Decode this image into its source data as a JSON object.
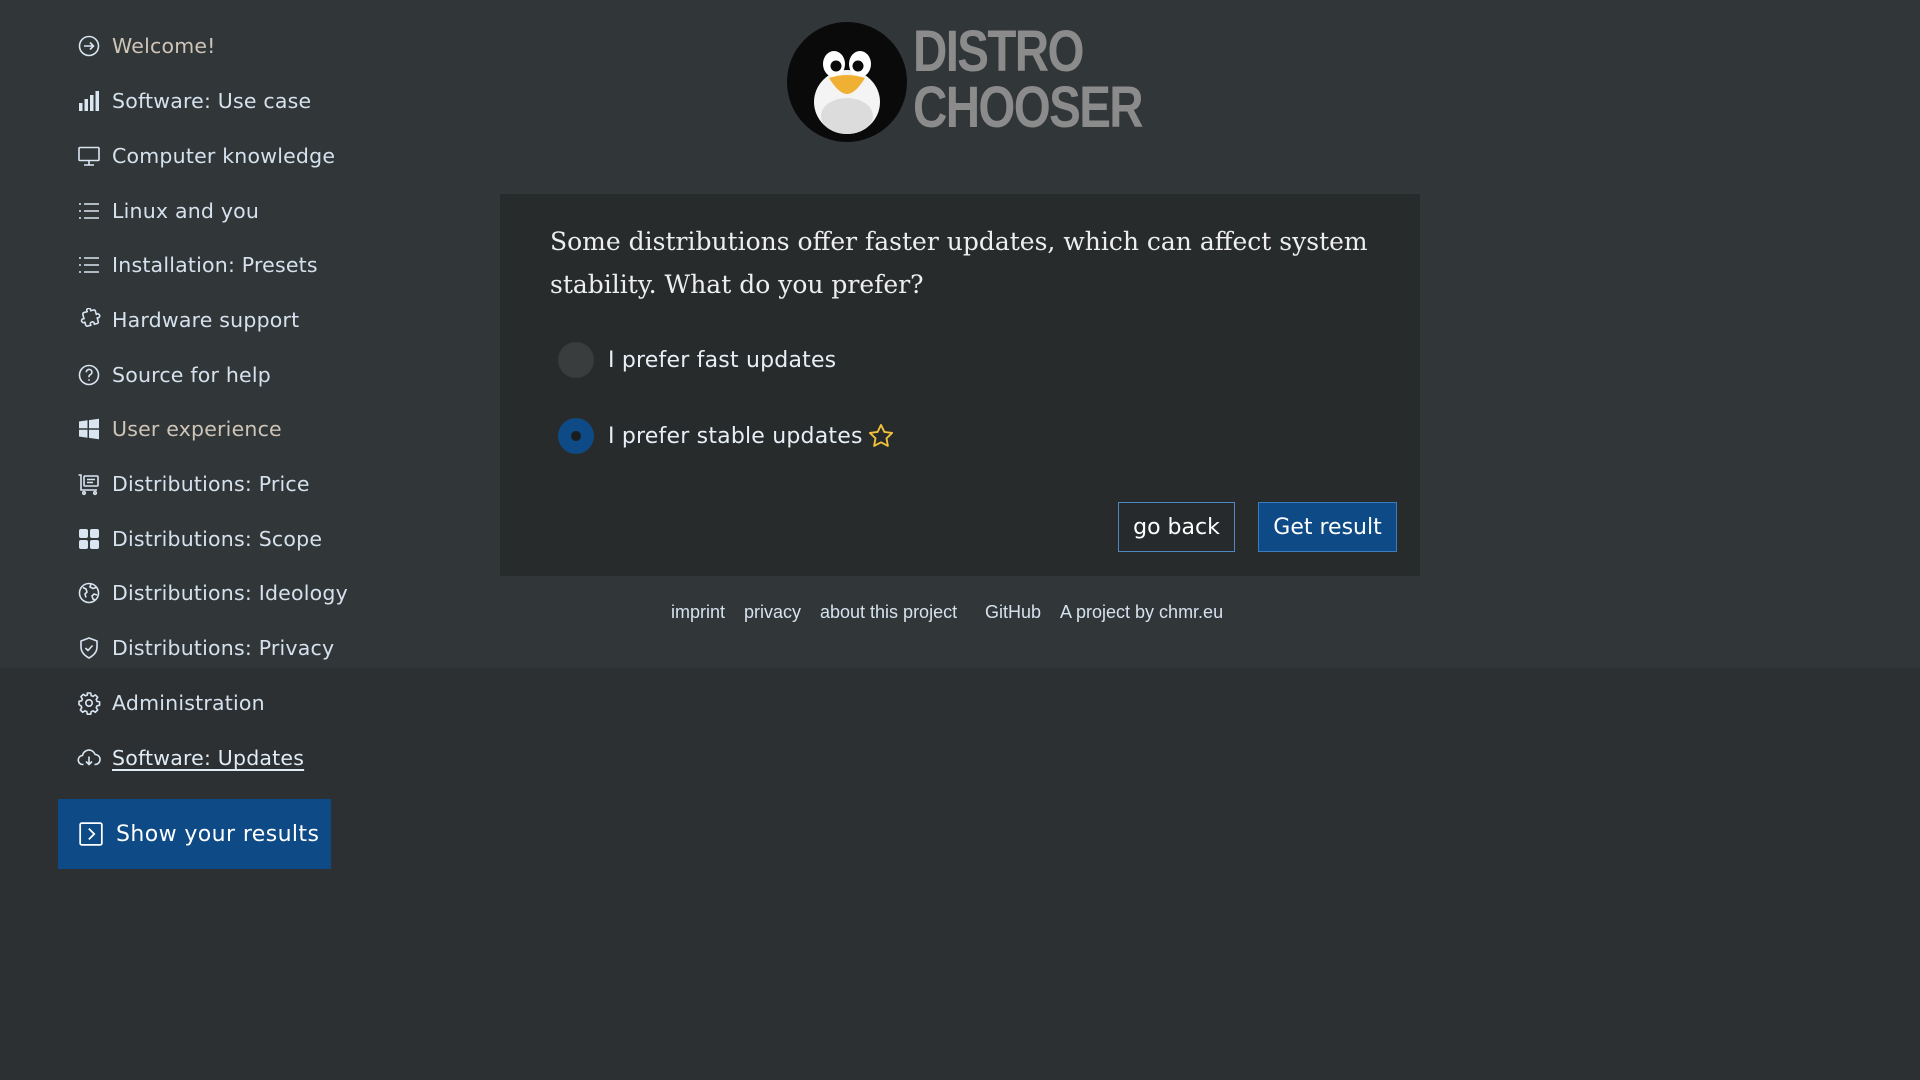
{
  "logo": {
    "line1": "DISTRO",
    "line2": "CHOOSER"
  },
  "sidebar": {
    "items": [
      {
        "label": "Welcome!",
        "icon": "arrow-in-circle-icon"
      },
      {
        "label": "Software: Use case",
        "icon": "bar-chart-icon"
      },
      {
        "label": "Computer knowledge",
        "icon": "monitor-icon"
      },
      {
        "label": "Linux and you",
        "icon": "list-icon"
      },
      {
        "label": "Installation: Presets",
        "icon": "list-icon"
      },
      {
        "label": "Hardware support",
        "icon": "puzzle-icon"
      },
      {
        "label": "Source for help",
        "icon": "question-circle-icon"
      },
      {
        "label": "User experience",
        "icon": "windows-icon"
      },
      {
        "label": "Distributions: Price",
        "icon": "cart-icon"
      },
      {
        "label": "Distributions: Scope",
        "icon": "grid-icon"
      },
      {
        "label": "Distributions: Ideology",
        "icon": "globe-icon"
      },
      {
        "label": "Distributions: Privacy",
        "icon": "shield-check-icon"
      },
      {
        "label": "Administration",
        "icon": "gear-icon"
      },
      {
        "label": "Software: Updates",
        "icon": "cloud-download-icon"
      }
    ],
    "results_button": "Show your results"
  },
  "question": {
    "text": "Some distributions offer faster updates, which can affect system stability. What do you prefer?",
    "options": [
      {
        "label": "I prefer fast updates",
        "selected": false
      },
      {
        "label": "I prefer stable updates",
        "selected": true
      }
    ],
    "back_label": "go back",
    "result_label": "Get result"
  },
  "footer": {
    "links": [
      "imprint",
      "privacy",
      "about this project",
      "GitHub",
      "A project by chmr.eu"
    ]
  },
  "colors": {
    "background": "#2c3032",
    "accent": "#0e4b86",
    "star": "#f0c23a"
  }
}
